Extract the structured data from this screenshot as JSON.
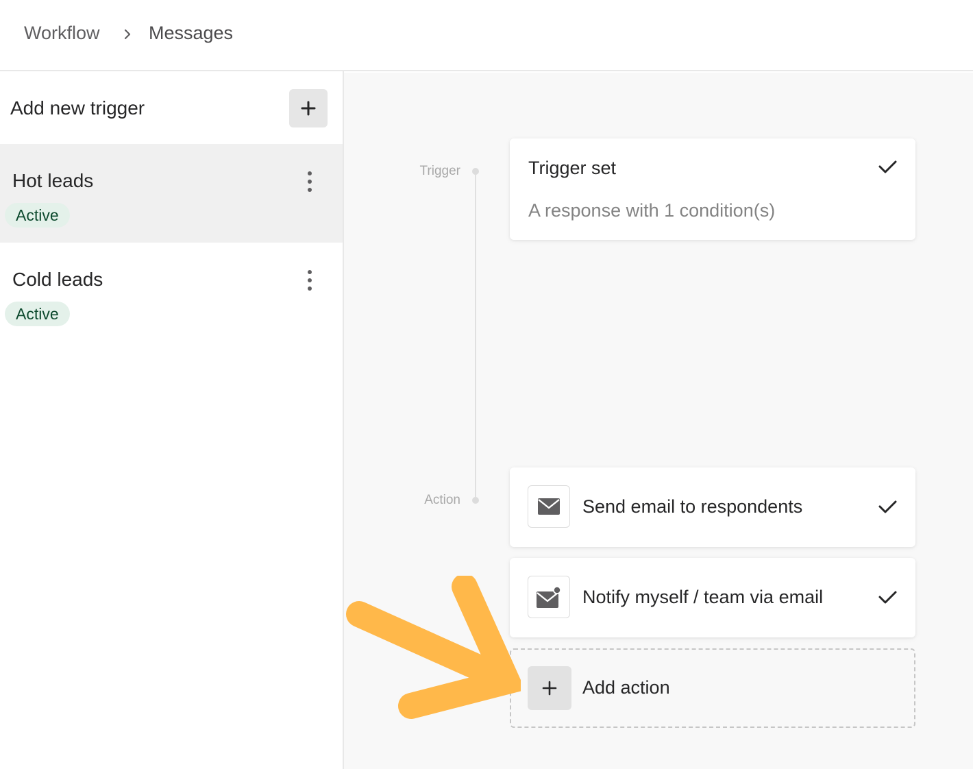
{
  "breadcrumb": {
    "items": [
      "Workflow",
      "Messages"
    ]
  },
  "sidebar": {
    "add_trigger_label": "Add new trigger",
    "triggers": [
      {
        "name": "Hot leads",
        "status": "Active",
        "selected": true
      },
      {
        "name": "Cold leads",
        "status": "Active",
        "selected": false
      }
    ]
  },
  "flow": {
    "stages": [
      "Trigger",
      "Action"
    ],
    "trigger_card": {
      "title": "Trigger set",
      "subtitle": "A response with 1 condition(s)",
      "complete": true
    },
    "actions": [
      {
        "label": "Send email to respondents",
        "icon": "envelope-icon",
        "complete": true
      },
      {
        "label": "Notify myself / team via email",
        "icon": "envelope-notify-icon",
        "complete": true
      }
    ],
    "add_action_label": "Add action"
  },
  "colors": {
    "badge_bg": "#e4f1ea",
    "badge_text": "#0d4a2e",
    "annotation_arrow": "#ffb84a",
    "selected_row": "#f0f0f0",
    "canvas_bg": "#f8f8f8"
  }
}
